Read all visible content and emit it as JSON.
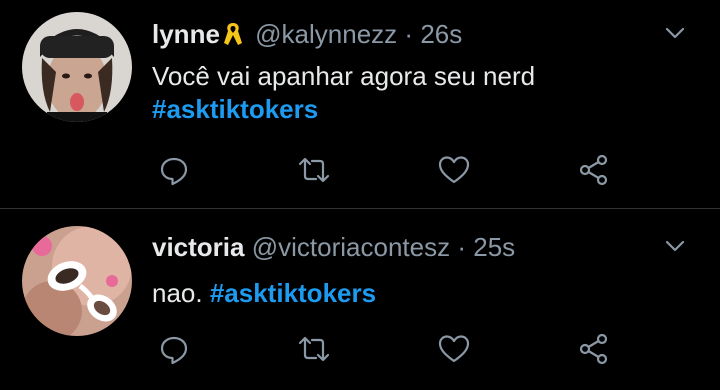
{
  "tweets": [
    {
      "name": "lynne",
      "handle": "@kalynnezz",
      "separator": "·",
      "time": "26s",
      "text_lines": [
        "Você vai apanhar agora seu nerd"
      ],
      "hashtag_line": "#asktiktokers",
      "badge_icon": "yellow-ribbon-icon"
    },
    {
      "name": "victoria",
      "handle": "@victoriacontesz",
      "separator": "·",
      "time": "25s",
      "text_prefix": "nao.",
      "hashtag": "#asktiktokers"
    }
  ],
  "icons": {
    "reply": "reply-icon",
    "retweet": "retweet-icon",
    "like": "like-icon",
    "share": "share-icon",
    "more": "chevron-down-icon"
  },
  "colors": {
    "background": "#000000",
    "text": "#e7e9ea",
    "muted": "#8b98a5",
    "hashtag": "#1d9bf0",
    "ribbon": "#f5c518",
    "divider": "#2f3336"
  }
}
